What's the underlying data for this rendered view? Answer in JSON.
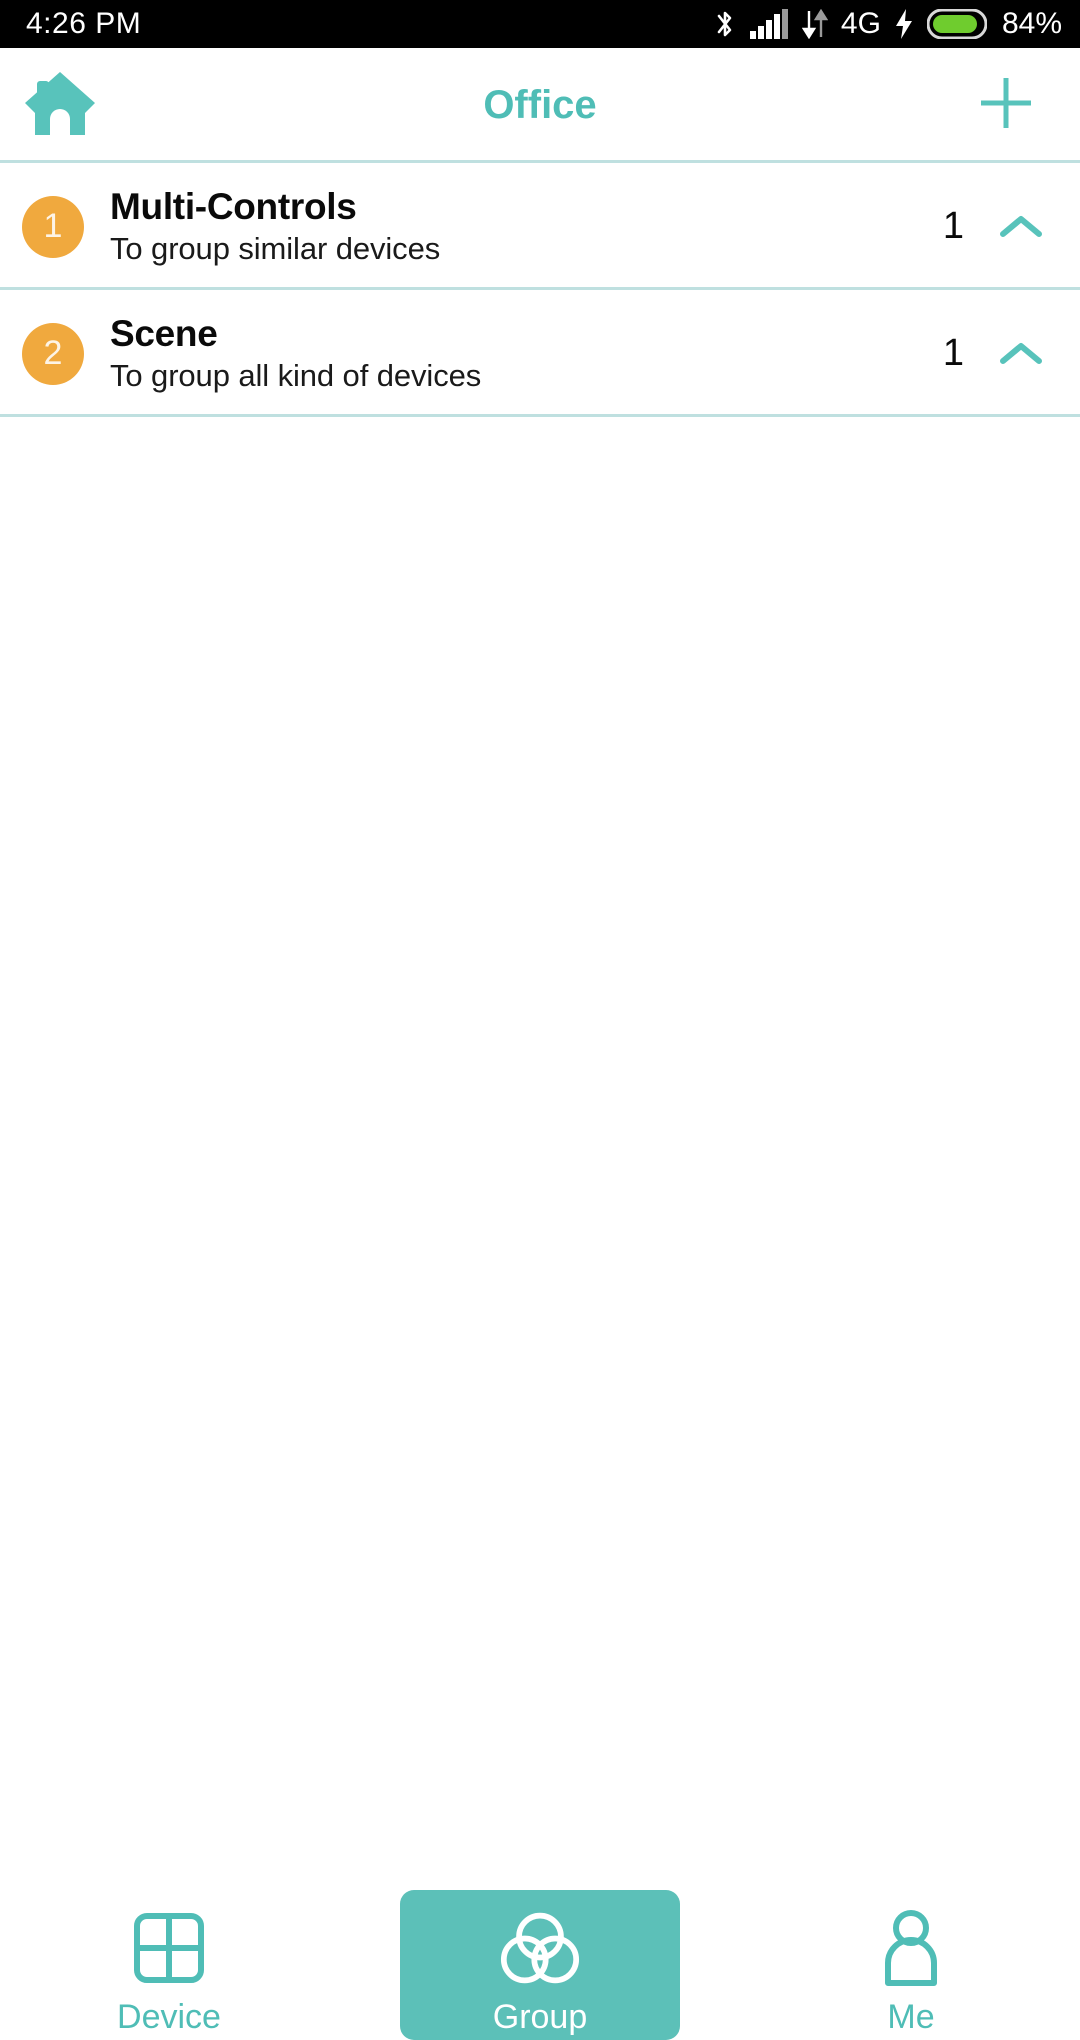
{
  "status_bar": {
    "time": "4:26 PM",
    "network_type": "4G",
    "battery_percent": "84%",
    "icons": [
      "bluetooth-icon",
      "signal-icon",
      "data-transfer-icon",
      "charging-bolt-icon",
      "battery-icon"
    ]
  },
  "header": {
    "home_icon": "home-icon",
    "title": "Office",
    "add_icon": "plus-icon",
    "accent_color": "#4fbdb6"
  },
  "list": {
    "rows": [
      {
        "badge": "1",
        "title": "Multi-Controls",
        "subtitle": "To group similar devices",
        "count": "1",
        "chevron": "chevron-up-icon"
      },
      {
        "badge": "2",
        "title": "Scene",
        "subtitle": "To group all kind of devices",
        "count": "1",
        "chevron": "chevron-up-icon"
      }
    ],
    "badge_color": "#f0a93e",
    "divider_color": "#bfe0e0"
  },
  "bottom_nav": {
    "active_bg": "#5cc0b8",
    "items": [
      {
        "label": "Device",
        "icon": "grid-icon",
        "active": false
      },
      {
        "label": "Group",
        "icon": "venn-circles-icon",
        "active": true
      },
      {
        "label": "Me",
        "icon": "person-icon",
        "active": false
      }
    ]
  }
}
